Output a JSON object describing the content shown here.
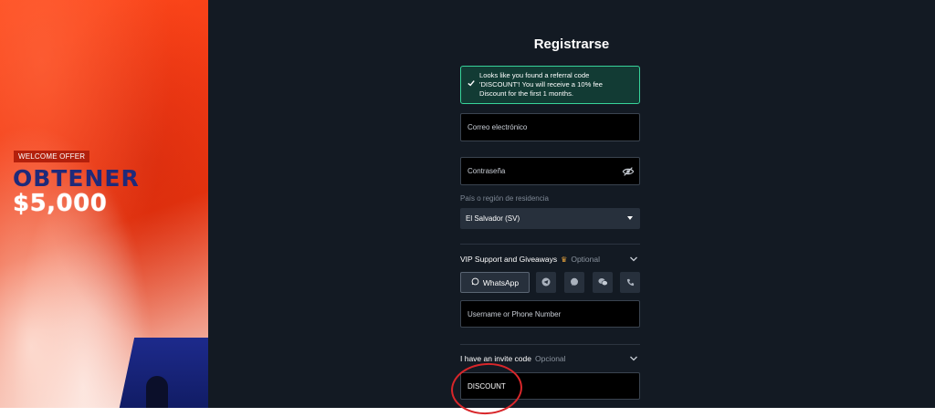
{
  "promo": {
    "badge": "WELCOME OFFER",
    "headline": "OBTENER",
    "amount": "$5,000"
  },
  "form": {
    "title": "Registrarse",
    "referral_alert": {
      "line1": "Looks like you found a referral code",
      "line2": "'DISCOUNT'! You will receive a 10% fee",
      "line3": "Discount for the first 1 months."
    },
    "email_placeholder": "Correo electrónico",
    "password_placeholder": "Contraseña",
    "country_label": "País o región de residencia",
    "country_value": "El Salvador (SV)",
    "vip_section": {
      "title": "VIP Support and Giveaways",
      "optional": "Optional",
      "whatsapp_label": "WhatsApp",
      "contact_icons": [
        "telegram-icon",
        "chat-icon",
        "wechat-icon",
        "phone-icon"
      ],
      "username_placeholder": "Username or Phone Number"
    },
    "invite_section": {
      "title": "I have an invite code",
      "optional": "Opcional",
      "code_value": "DISCOUNT"
    }
  },
  "colors": {
    "background": "#131a23",
    "promo_red": "#f13a14",
    "success_border": "#37d39a",
    "annotation_red": "#d8262a"
  }
}
